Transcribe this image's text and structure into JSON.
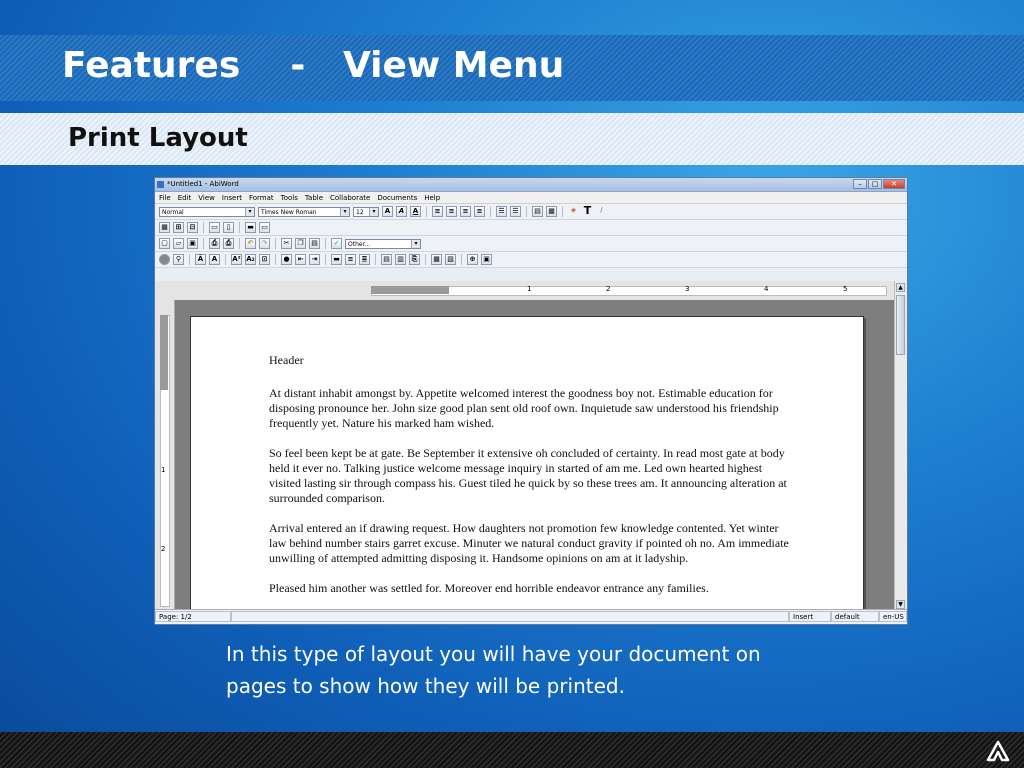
{
  "slide": {
    "title": "Features    -   View Menu",
    "subtitle": "Print Layout",
    "caption": "In this type of layout you will have your document on pages to show how they will be printed."
  },
  "window": {
    "title": "*Untitled1 - AbiWord",
    "menu": [
      "File",
      "Edit",
      "View",
      "Insert",
      "Format",
      "Tools",
      "Table",
      "Collaborate",
      "Documents",
      "Help"
    ],
    "style_combo": "Normal",
    "font_combo": "Times New Roman",
    "size_combo": "12",
    "spell_combo": "Other...",
    "ruler_numbers": [
      "1",
      "2",
      "3",
      "4",
      "5"
    ],
    "vruler_numbers": [
      "1",
      "2"
    ]
  },
  "document": {
    "header": "Header",
    "paragraphs": [
      "At distant inhabit amongst by. Appetite welcomed interest the goodness boy not. Estimable education for disposing pronounce her. John size good plan sent old roof own. Inquietude saw understood his friendship frequently yet. Nature his marked ham wished.",
      "So feel been kept be at gate. Be September it extensive oh concluded of certainty. In read most gate at body held it ever no. Talking justice welcome message inquiry in started of am me. Led own hearted highest visited lasting sir through compass his. Guest tiled he quick by so these trees am. It announcing alteration at surrounded comparison.",
      "Arrival entered an if drawing request. How daughters not promotion few knowledge contented. Yet winter law behind number stairs garret excuse. Minuter we natural conduct gravity if pointed oh no. Am immediate unwilling of attempted admitting disposing it. Handsome opinions on am at it ladyship.",
      "Pleased him another was settled for. Moreover end horrible endeavor entrance any families."
    ]
  },
  "status": {
    "page": "Page: 1/2",
    "mode": "Insert",
    "style": "default",
    "lang": "en-US"
  }
}
